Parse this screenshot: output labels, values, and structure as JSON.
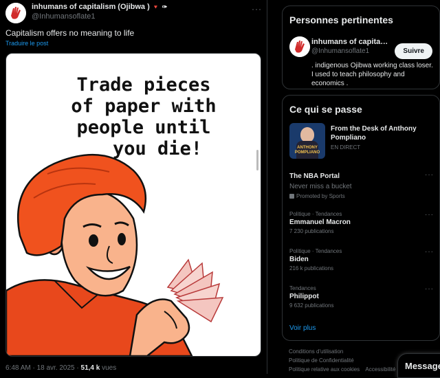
{
  "post": {
    "author_name": "inhumans of capitalism (Ojibwa )",
    "badge_heart": "🔻",
    "badge_pin": "✑",
    "handle": "@Inhumansoflate1",
    "more": "···",
    "text": "Capitalism offers no meaning to life",
    "translate": "Traduire le post",
    "meme_lines": [
      "Trade pieces",
      "of paper with",
      "people until",
      "you die!"
    ],
    "timestamp": "6:48 AM · 18 avr. 2025 · ",
    "views_count": "51,4 k",
    "views_label": " vues"
  },
  "relevant": {
    "title": "Personnes pertinentes",
    "name": "inhumans of capitalis...",
    "handle": "@Inhumansoflate1",
    "follow_label": "Suivre",
    "bio": ". indigenous Ojibwa working class loser. I used to teach philosophy and economics ."
  },
  "happening": {
    "title": "Ce qui se passe",
    "live": {
      "title": "From the Desk of Anthony Pompliano",
      "status": "EN DIRECT",
      "thumb_text_1": "ANTHONY",
      "thumb_text_2": "POMPLIANO"
    },
    "trends": [
      {
        "meta": "",
        "title": "The NBA Portal",
        "sub": "Never miss a bucket",
        "sub2": "Promoted by Sports"
      },
      {
        "meta": "Politique · Tendances",
        "title": "Emmanuel Macron",
        "sub": "7 230 publications"
      },
      {
        "meta": "Politique · Tendances",
        "title": "Biden",
        "sub": "216 k publications"
      },
      {
        "meta": "Tendances",
        "title": "Philippot",
        "sub": "9 632 publications"
      }
    ],
    "show_more": "Voir plus"
  },
  "footer": {
    "links": [
      "Conditions d'utilisation",
      "Politique de Confidentialité",
      "Politique relative aux cookies",
      "Accessibilité"
    ]
  },
  "messages": {
    "label": "Message"
  },
  "colors": {
    "accent": "#1d9bf0",
    "bg": "#000000",
    "border": "#2f3336"
  }
}
